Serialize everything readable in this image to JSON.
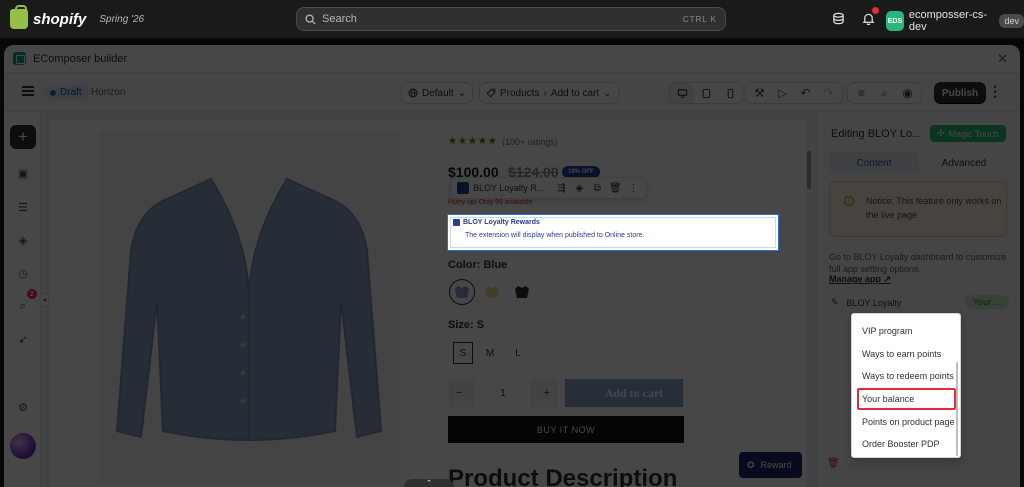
{
  "shopify": {
    "brand": "shopify",
    "edition": "Spring '26",
    "search_placeholder": "Search",
    "search_shortcut": "CTRL  K",
    "store_initials": "EDS",
    "store_name": "ecomposser-cs-dev",
    "store_badge": "dev"
  },
  "app": {
    "title": "EComposer builder",
    "status": "Draft",
    "theme": "Horizon",
    "view_select": "Default",
    "breadcrumb_1": "Products",
    "breadcrumb_2": "Add to cart",
    "publish": "Publish"
  },
  "rail": {
    "notifications_count": "2"
  },
  "product": {
    "stars": "★★★★★",
    "ratings": "(100+ ratings)",
    "price": "$100.00",
    "compare_price": "$124.00",
    "discount": "19% OFF",
    "hurry": "Hurry up! Only 99 available",
    "color_label": "Color:",
    "color_value": "Blue",
    "size_label": "Size:",
    "size_value": "S",
    "sizes": [
      "S",
      "M",
      "L"
    ],
    "qty": "1",
    "qty_minus": "−",
    "qty_plus": "+",
    "add_to_cart": "Add to cart",
    "buy_now": "BUY IT NOW",
    "description_heading": "Product Description",
    "reward_button": "Reward"
  },
  "element_toolbar": {
    "name": "BLOY Loyalty R..."
  },
  "bloy_block": {
    "title": "BLOY Loyalty Rewards",
    "description": "The extension will display when published to Online store."
  },
  "panel": {
    "title": "Editing BLOY Lo...",
    "magic_touch": "Magic Touch",
    "tabs": [
      "Content",
      "Advanced"
    ],
    "notice": "Notice: This feature only works on the live page",
    "goto_text": "Go to BLOY Loyalty dashboard to customize full app setting options.",
    "manage_app": "Manage app",
    "setting_label": "BLOY Loyalty",
    "setting_value": "Your ..."
  },
  "dropdown": {
    "options": [
      "VIP program",
      "Ways to earn points",
      "Ways to redeem points",
      "Your balance",
      "Points on product page",
      "Order Booster PDP"
    ],
    "selected": "Your balance"
  }
}
